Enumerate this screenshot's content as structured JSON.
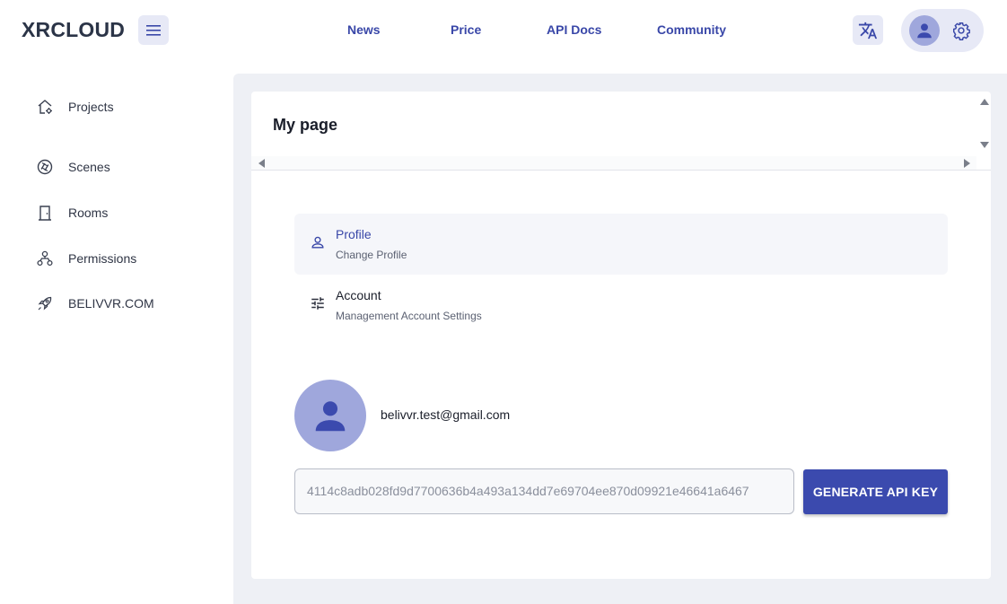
{
  "header": {
    "logo": "XRCLOUD",
    "nav": [
      "News",
      "Price",
      "API Docs",
      "Community"
    ]
  },
  "sidebar": {
    "items": [
      {
        "label": "Projects",
        "icon": "home-gear-icon"
      },
      {
        "label": "Scenes",
        "icon": "aperture-icon"
      },
      {
        "label": "Rooms",
        "icon": "door-icon"
      },
      {
        "label": "Permissions",
        "icon": "hierarchy-icon"
      },
      {
        "label": "BELIVVR.COM",
        "icon": "rocket-icon"
      }
    ]
  },
  "main": {
    "title": "My page",
    "menu": [
      {
        "title": "Profile",
        "subtitle": "Change Profile",
        "icon": "user-icon",
        "active": true
      },
      {
        "title": "Account",
        "subtitle": "Management Account Settings",
        "icon": "sliders-icon",
        "active": false
      }
    ],
    "email": "belivvr.test@gmail.com",
    "api_key": "4114c8adb028fd9d7700636b4a493a134dd7e69704ee870d09921e46641a6467",
    "generate_button": "GENERATE API KEY"
  },
  "colors": {
    "accent": "#3b4aae",
    "nav_text": "#3947a8",
    "chip_bg": "#e7e9f6",
    "avatar_bg": "#9fa7dc",
    "main_bg": "#eef0f5"
  }
}
